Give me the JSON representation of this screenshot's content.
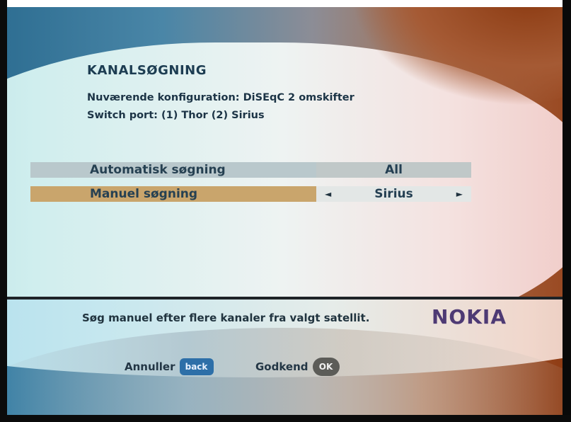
{
  "header": {
    "title": "KANALSØGNING",
    "config_line_1": "Nuværende konfiguration:  DiSEqC 2 omskifter",
    "config_line_2": "Switch port:  (1) Thor  (2) Sirius"
  },
  "menu": {
    "items": [
      {
        "label": "Automatisk søgning",
        "value": "All",
        "selected": false
      },
      {
        "label": "Manuel søgning",
        "value": "Sirius",
        "selected": true
      }
    ],
    "arrow_left": "◄",
    "arrow_right": "►"
  },
  "footer": {
    "help_text": "Søg manuel efter flere kanaler fra valgt satellit.",
    "brand": "NOKIA",
    "cancel_label": "Annuller",
    "cancel_key": "back",
    "confirm_label": "Godkend",
    "confirm_key": "OK"
  },
  "colors": {
    "selected_row": "#c9a56c",
    "unselected_row": "#b9c8cc",
    "brand": "#4e3a74",
    "back_key": "#2d6fa8",
    "ok_key": "#5c5c58"
  }
}
